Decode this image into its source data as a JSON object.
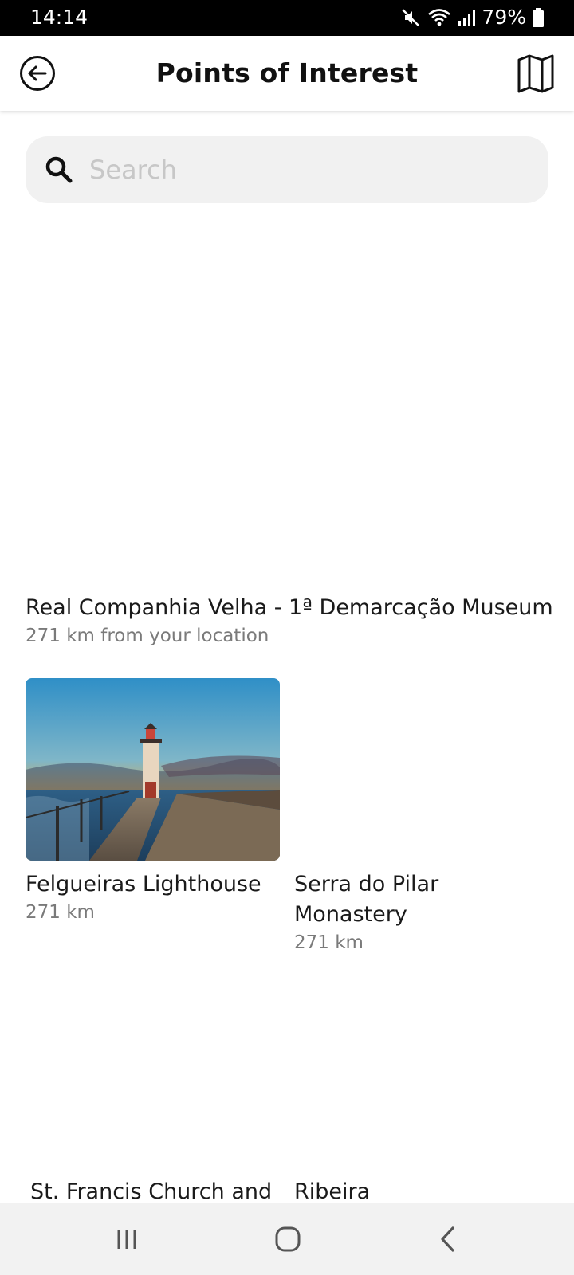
{
  "status_bar": {
    "time": "14:14",
    "battery": "79%"
  },
  "header": {
    "title": "Points of Interest",
    "back_icon": "arrow-left-circle-icon",
    "map_icon": "map-icon"
  },
  "search": {
    "placeholder": "Search",
    "value": ""
  },
  "pois": [
    {
      "name": "Real Companhia Velha - 1ª Demarcação Museum",
      "distance": "271 km from your location"
    },
    {
      "name": "Felgueiras Lighthouse",
      "distance": "271 km"
    },
    {
      "name": "Serra do Pilar Monastery",
      "name_line1": "Serra do Pilar",
      "name_line2": "Monastery",
      "distance": "271 km"
    },
    {
      "name": "St. Francis Church and"
    },
    {
      "name": "Ribeira"
    }
  ],
  "nav": {
    "recents_icon": "recents-icon",
    "home_icon": "home-icon",
    "back_icon": "chevron-left-icon"
  },
  "colors": {
    "status_bar": "#000000",
    "app_bar": "#ffffff",
    "search_bg": "#f1f1f1",
    "placeholder": "#c7c7c7",
    "secondary_text": "#7a7a7a",
    "nav_bar": "#f2f2f2"
  }
}
